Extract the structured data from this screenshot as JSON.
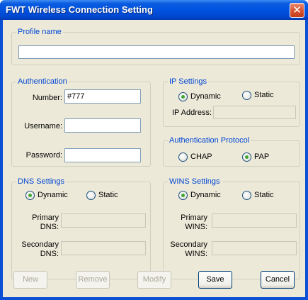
{
  "window": {
    "title": "FWT Wireless Connection Setting"
  },
  "profile": {
    "legend": "Profile name",
    "value": ""
  },
  "auth": {
    "legend": "Authentication",
    "number_label": "Number:",
    "number_value": "#777",
    "username_label": "Username:",
    "username_value": "",
    "password_label": "Password:",
    "password_value": ""
  },
  "ip": {
    "legend": "IP Settings",
    "dynamic": "Dynamic",
    "static": "Static",
    "selected": "Dynamic",
    "address_label": "IP Address:",
    "address_value": ""
  },
  "auth_protocol": {
    "legend": "Authentication Protocol",
    "chap": "CHAP",
    "pap": "PAP",
    "selected": "PAP"
  },
  "dns": {
    "legend": "DNS Settings",
    "dynamic": "Dynamic",
    "static": "Static",
    "selected": "Dynamic",
    "primary_label_1": "Primary",
    "primary_label_2": "DNS:",
    "secondary_label_1": "Secondary",
    "secondary_label_2": "DNS:"
  },
  "wins": {
    "legend": "WINS Settings",
    "dynamic": "Dynamic",
    "static": "Static",
    "selected": "Dynamic",
    "primary_label_1": "Primary",
    "primary_label_2": "WINS:",
    "secondary_label_1": "Secondary",
    "secondary_label_2": "WINS:"
  },
  "buttons": {
    "new": "New",
    "remove": "Remove",
    "modify": "Modify",
    "save": "Save",
    "cancel": "Cancel"
  },
  "colors": {
    "titlebar": "#0053e0",
    "client_bg": "#ece9d8",
    "group_legend": "#0046d5",
    "radio_selected": "#3fa62f"
  }
}
